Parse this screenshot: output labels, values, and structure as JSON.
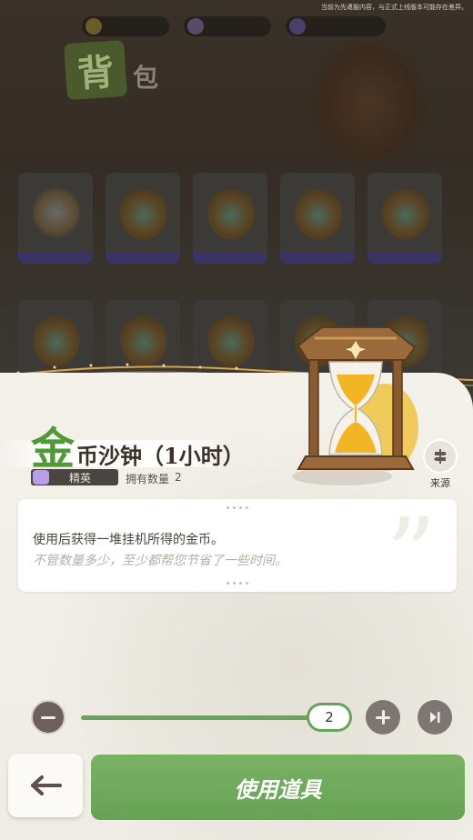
{
  "notice": "当前为先遣服内容，与正式上线版本可能存在差异。",
  "background": {
    "bag_title_big": "背",
    "bag_title_small": "包",
    "currency_pills": [
      "",
      "",
      ""
    ]
  },
  "item": {
    "name_first": "金",
    "name_rest": "币沙钟（1小时）",
    "rarity_label": "精英",
    "owned_label": "拥有数量",
    "owned_count": "2"
  },
  "source": {
    "label": "来源",
    "icon": "signpost-icon"
  },
  "description": {
    "line1": "使用后获得一堆挂机所得的金币。",
    "line2": "不管数量多少，至少都帮您节省了一些时间。"
  },
  "quantity": {
    "value": "2",
    "fill_fraction": 0.98
  },
  "actions": {
    "use_label": "使用道具",
    "back_icon": "back-arrow-icon"
  },
  "colors": {
    "accent_green": "#66a45a",
    "title_green": "#4f9a36",
    "rarity_purple": "#b99de8"
  }
}
